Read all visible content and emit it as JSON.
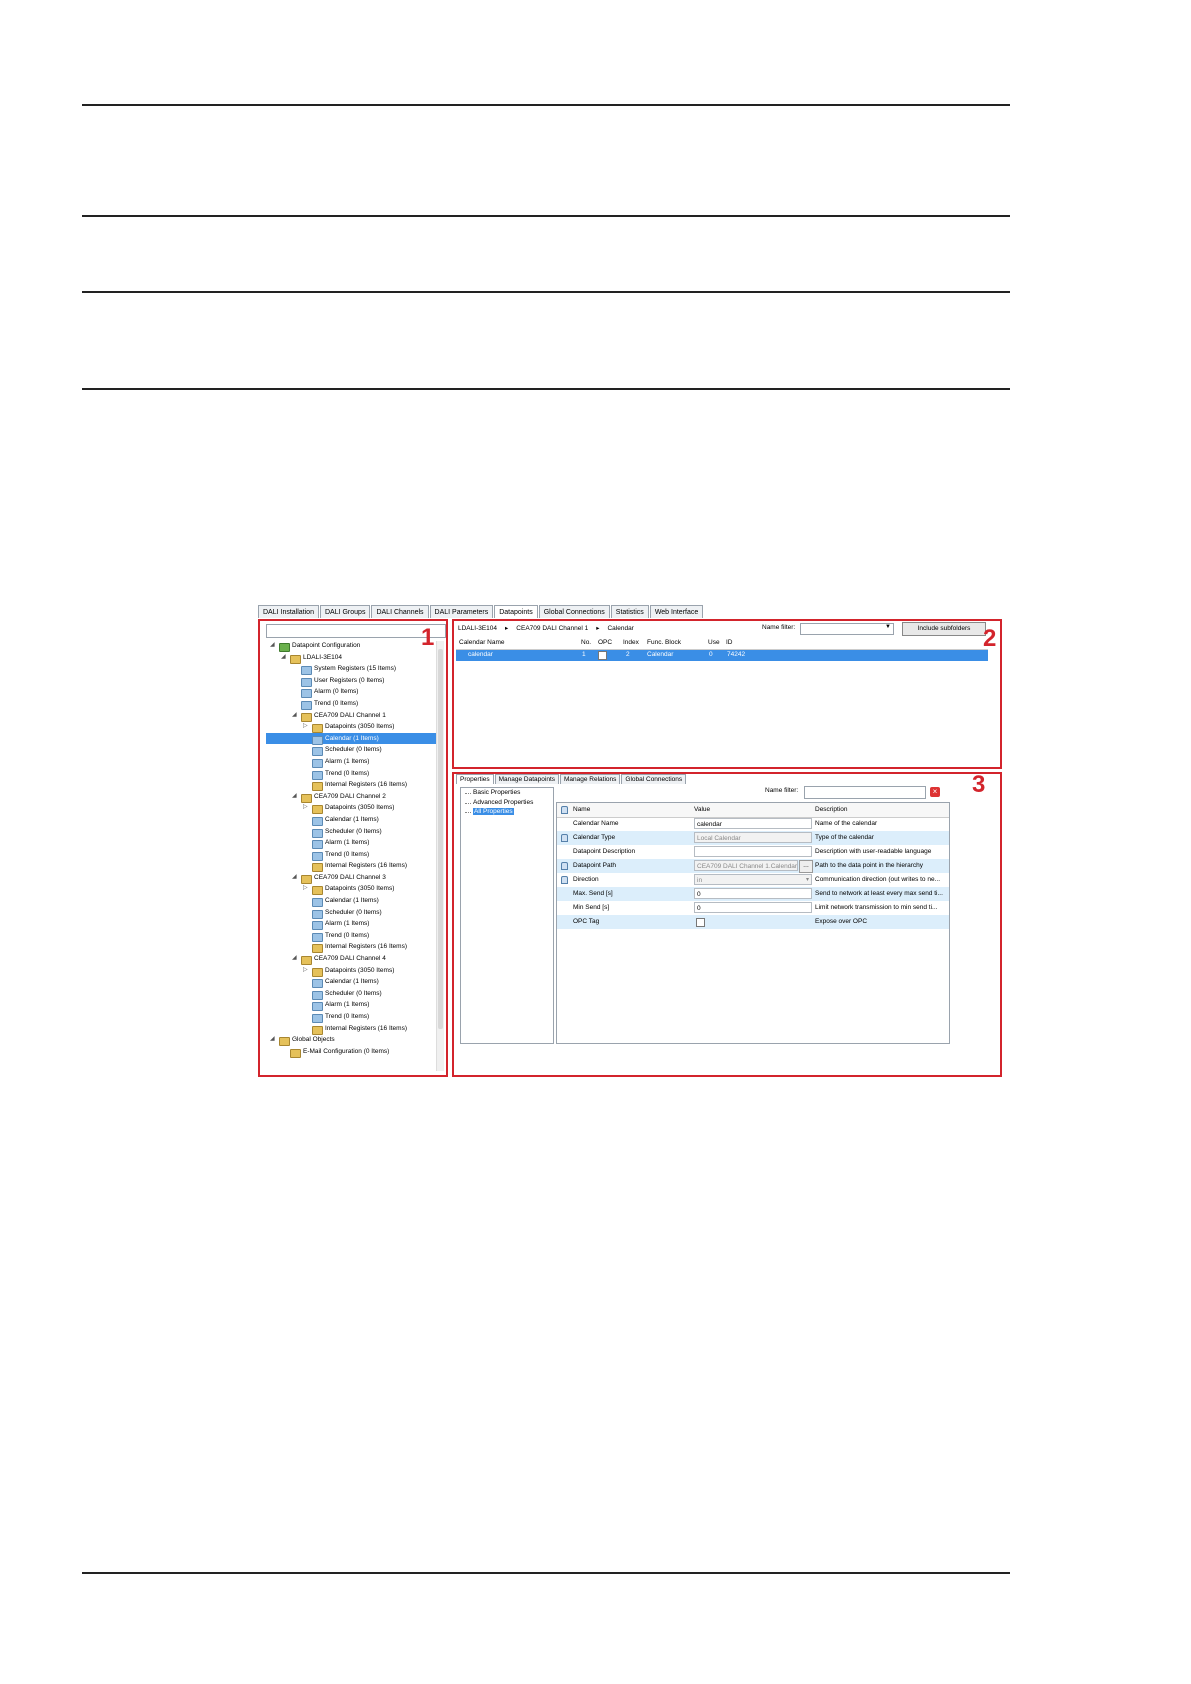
{
  "window": {
    "tabs": [
      "DALI Installation",
      "DALI Groups",
      "DALI Channels",
      "DALI Parameters",
      "Datapoints",
      "Global Connections",
      "Statistics",
      "Web Interface"
    ],
    "active_tab": "Datapoints"
  },
  "callouts": [
    "1",
    "2",
    "3"
  ],
  "tree": {
    "items": [
      {
        "label": "Datapoint Configuration",
        "level": 0,
        "expander": "◢",
        "icon": "green-folder-icon"
      },
      {
        "label": "LDALI-3E104",
        "level": 1,
        "expander": "◢",
        "icon": "yellow-folder-icon"
      },
      {
        "label": "System Registers (15 Items)",
        "level": 2,
        "expander": "",
        "icon": "blue-folder-icon"
      },
      {
        "label": "User Registers (0 Items)",
        "level": 2,
        "expander": "",
        "icon": "blue-folder-icon"
      },
      {
        "label": "Alarm (0 Items)",
        "level": 2,
        "expander": "",
        "icon": "blue-folder-icon"
      },
      {
        "label": "Trend (0 Items)",
        "level": 2,
        "expander": "",
        "icon": "blue-folder-icon"
      },
      {
        "label": "CEA709 DALI Channel 1",
        "level": 2,
        "expander": "◢",
        "icon": "yellow-folder-icon"
      },
      {
        "label": "Datapoints (3050 Items)",
        "level": 3,
        "expander": "▷",
        "icon": "yellow-folder-icon"
      },
      {
        "label": "Calendar (1 Items)",
        "level": 3,
        "expander": "",
        "icon": "blue-folder-icon",
        "selected": true
      },
      {
        "label": "Scheduler (0 Items)",
        "level": 3,
        "expander": "",
        "icon": "blue-folder-icon"
      },
      {
        "label": "Alarm (1 Items)",
        "level": 3,
        "expander": "",
        "icon": "blue-folder-icon"
      },
      {
        "label": "Trend (0 Items)",
        "level": 3,
        "expander": "",
        "icon": "blue-folder-icon"
      },
      {
        "label": "Internal Registers (16 Items)",
        "level": 3,
        "expander": "",
        "icon": "yellow-folder-icon"
      },
      {
        "label": "CEA709 DALI Channel 2",
        "level": 2,
        "expander": "◢",
        "icon": "yellow-folder-icon"
      },
      {
        "label": "Datapoints (3050 Items)",
        "level": 3,
        "expander": "▷",
        "icon": "yellow-folder-icon"
      },
      {
        "label": "Calendar (1 Items)",
        "level": 3,
        "expander": "",
        "icon": "blue-folder-icon"
      },
      {
        "label": "Scheduler (0 Items)",
        "level": 3,
        "expander": "",
        "icon": "blue-folder-icon"
      },
      {
        "label": "Alarm (1 Items)",
        "level": 3,
        "expander": "",
        "icon": "blue-folder-icon"
      },
      {
        "label": "Trend (0 Items)",
        "level": 3,
        "expander": "",
        "icon": "blue-folder-icon"
      },
      {
        "label": "Internal Registers (16 Items)",
        "level": 3,
        "expander": "",
        "icon": "yellow-folder-icon"
      },
      {
        "label": "CEA709 DALI Channel 3",
        "level": 2,
        "expander": "◢",
        "icon": "yellow-folder-icon"
      },
      {
        "label": "Datapoints (3050 Items)",
        "level": 3,
        "expander": "▷",
        "icon": "yellow-folder-icon"
      },
      {
        "label": "Calendar (1 Items)",
        "level": 3,
        "expander": "",
        "icon": "blue-folder-icon"
      },
      {
        "label": "Scheduler (0 Items)",
        "level": 3,
        "expander": "",
        "icon": "blue-folder-icon"
      },
      {
        "label": "Alarm (1 Items)",
        "level": 3,
        "expander": "",
        "icon": "blue-folder-icon"
      },
      {
        "label": "Trend (0 Items)",
        "level": 3,
        "expander": "",
        "icon": "blue-folder-icon"
      },
      {
        "label": "Internal Registers (16 Items)",
        "level": 3,
        "expander": "",
        "icon": "yellow-folder-icon"
      },
      {
        "label": "CEA709 DALI Channel 4",
        "level": 2,
        "expander": "◢",
        "icon": "yellow-folder-icon"
      },
      {
        "label": "Datapoints (3050 Items)",
        "level": 3,
        "expander": "▷",
        "icon": "yellow-folder-icon"
      },
      {
        "label": "Calendar (1 Items)",
        "level": 3,
        "expander": "",
        "icon": "blue-folder-icon"
      },
      {
        "label": "Scheduler (0 Items)",
        "level": 3,
        "expander": "",
        "icon": "blue-folder-icon"
      },
      {
        "label": "Alarm (1 Items)",
        "level": 3,
        "expander": "",
        "icon": "blue-folder-icon"
      },
      {
        "label": "Trend (0 Items)",
        "level": 3,
        "expander": "",
        "icon": "blue-folder-icon"
      },
      {
        "label": "Internal Registers (16 Items)",
        "level": 3,
        "expander": "",
        "icon": "yellow-folder-icon"
      },
      {
        "label": "Global Objects",
        "level": 0,
        "expander": "◢",
        "icon": "yellow-folder-icon"
      },
      {
        "label": "E-Mail Configuration (0 Items)",
        "level": 1,
        "expander": "",
        "icon": "yellow-folder-icon"
      }
    ]
  },
  "list_panel": {
    "breadcrumb": [
      "LDALI-3E104",
      "CEA709 DALI Channel 1",
      "Calendar"
    ],
    "name_filter_label": "Name filter:",
    "name_filter_value": "",
    "include_subfolders_label": "Include subfolders",
    "columns": [
      "Calendar Name",
      "No.",
      "OPC",
      "Index",
      "Func. Block",
      "Use",
      "ID"
    ],
    "rows": [
      {
        "name": "calendar",
        "no": "1",
        "index": "2",
        "func_block": "Calendar",
        "use": "0",
        "id": "74242"
      }
    ]
  },
  "properties_panel": {
    "tabs": [
      "Properties",
      "Manage Datapoints",
      "Manage Relations",
      "Global Connections"
    ],
    "active_tab": "Properties",
    "categories": [
      "Basic Properties",
      "Advanced Properties",
      "All Properties"
    ],
    "selected_category": "All Properties",
    "name_filter_label": "Name filter:",
    "name_filter_value": "",
    "columns": [
      "Name",
      "Value",
      "Description"
    ],
    "rows": [
      {
        "name": "Calendar Name",
        "value": "calendar",
        "description": "Name of the calendar",
        "locked": false,
        "readonly": false
      },
      {
        "name": "Calendar Type",
        "value": "Local Calendar",
        "description": "Type of the calendar",
        "locked": true,
        "readonly": true
      },
      {
        "name": "Datapoint Description",
        "value": "",
        "description": "Description with user-readable language",
        "locked": false,
        "readonly": false
      },
      {
        "name": "Datapoint Path",
        "value": "CEA709 DALI Channel 1.Calendar",
        "description": "Path to the data point in the hierarchy",
        "locked": true,
        "readonly": true
      },
      {
        "name": "Direction",
        "value": "in",
        "description": "Communication direction (out writes to ne...",
        "locked": true,
        "readonly": true
      },
      {
        "name": "Max. Send [s]",
        "value": "0",
        "description": "Send to network at least every max send ti...",
        "locked": false,
        "readonly": false
      },
      {
        "name": "Min Send [s]",
        "value": "0",
        "description": "Limit network transmission to min send ti...",
        "locked": false,
        "readonly": false
      },
      {
        "name": "OPC Tag",
        "value": "",
        "description": "Expose over OPC",
        "locked": false,
        "readonly": false
      }
    ]
  }
}
